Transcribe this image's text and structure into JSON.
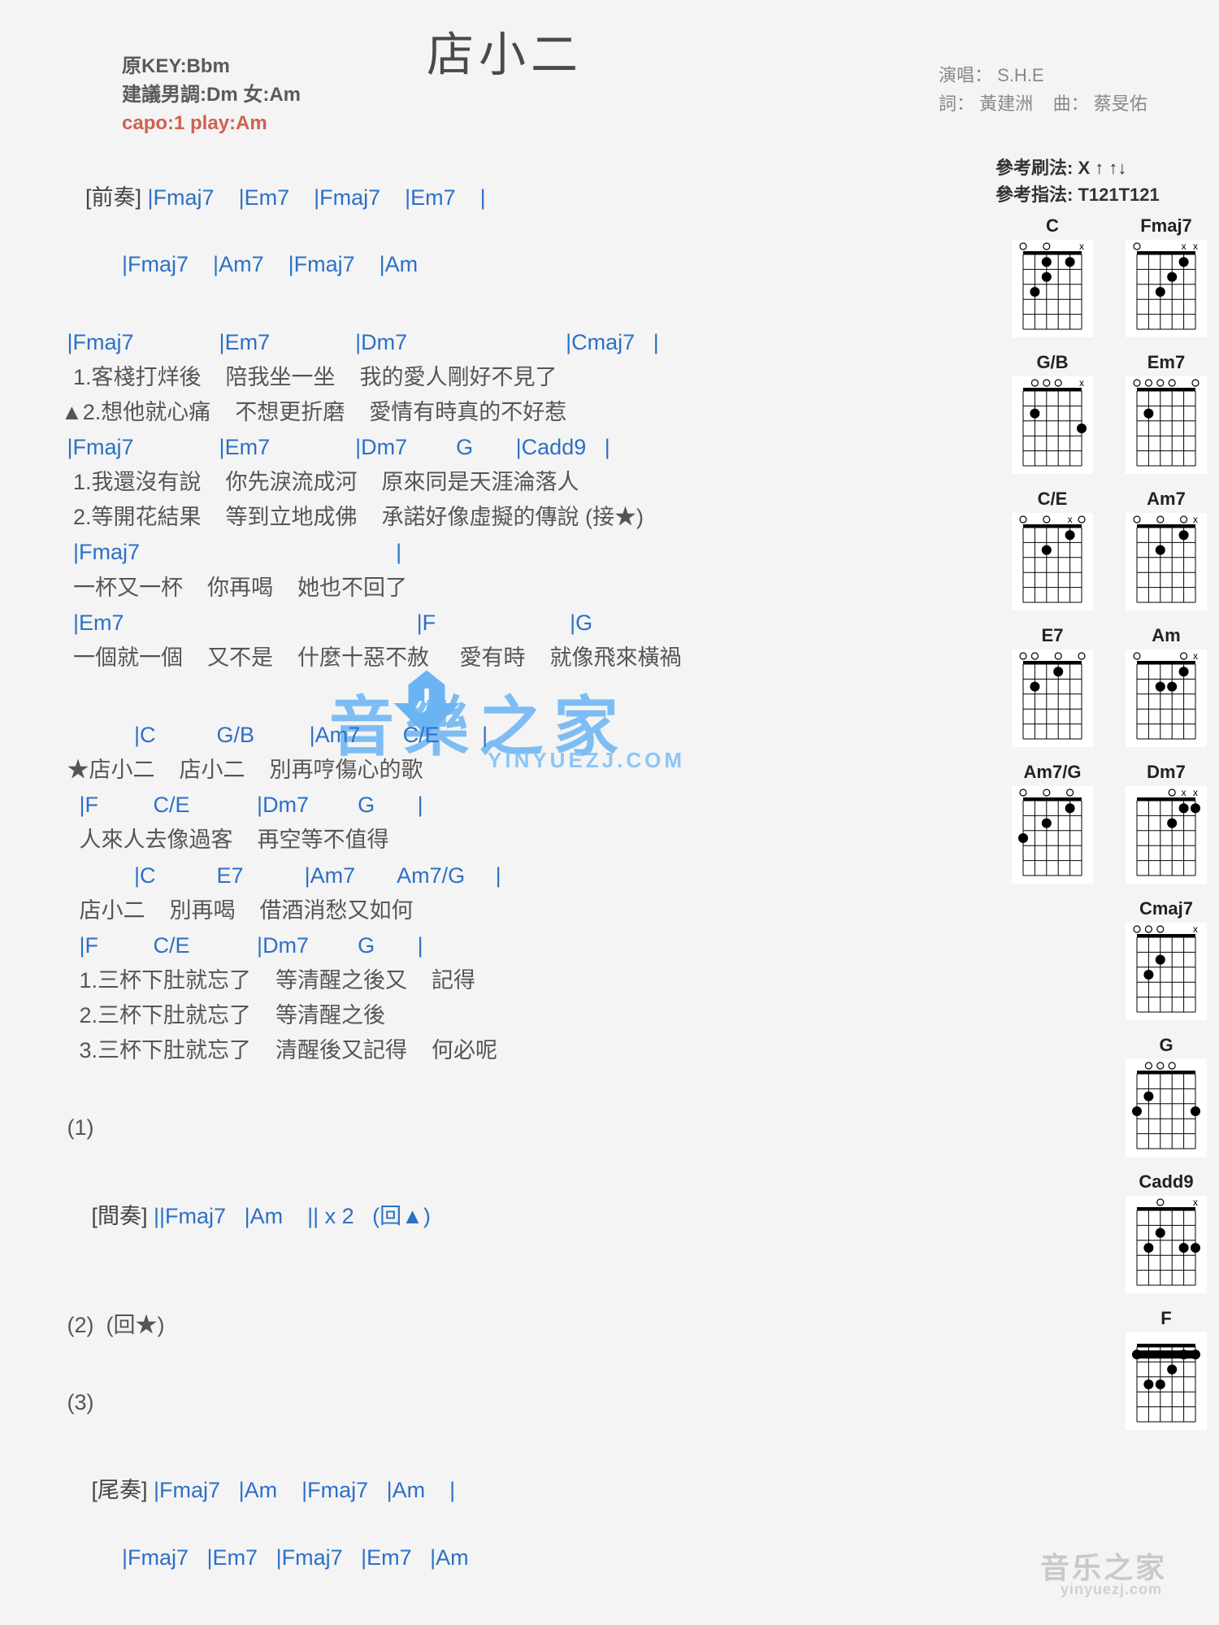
{
  "title": "店小二",
  "meta": {
    "original_key": "原KEY:Bbm",
    "suggest": "建議男調:Dm 女:Am",
    "capo": "capo:1 play:Am",
    "singer_label": "演唱：",
    "singer": "S.H.E",
    "lyricist_label": "詞：",
    "lyricist": "黃建洲",
    "composer_label": "曲：",
    "composer": "蔡旻佑",
    "strum_label": "參考刷法:",
    "strum": "X ↑ ↑↓",
    "finger_label": "參考指法:",
    "finger": "T121T121"
  },
  "sections": {
    "intro_label": "[前奏]",
    "intro_l1": " |Fmaj7    |Em7    |Fmaj7    |Em7    |",
    "intro_l2": "          |Fmaj7    |Am7    |Fmaj7    |Am",
    "v_c1": " |Fmaj7              |Em7              |Dm7                          |Cmaj7   |",
    "v_l1a": "  1.客棧打烊後    陪我坐一坐    我的愛人剛好不見了",
    "v_l1b": "▲2.想他就心痛    不想更折磨    愛情有時真的不好惹",
    "v_c2": " |Fmaj7              |Em7              |Dm7        G       |Cadd9   |",
    "v_l2a": "  1.我還沒有說    你先淚流成河    原來同是天涯淪落人",
    "v_l2b": "  2.等開花結果    等到立地成佛    承諾好像虛擬的傳說 (接★)",
    "v_c3": "  |Fmaj7                                          |",
    "v_l3": "  一杯又一杯    你再喝    她也不回了",
    "v_c4": "  |Em7                                                |F                      |G",
    "v_l4": "  一個就一個    又不是    什麼十惡不赦     愛有時    就像飛來橫禍",
    "ch_c1": "            |C          G/B         |Am7       C/E       |",
    "ch_l1": " ★店小二    店小二    別再哼傷心的歌",
    "ch_c2": "   |F         C/E           |Dm7        G       |",
    "ch_l2": "   人來人去像過客    再空等不值得",
    "ch_c3": "            |C          E7          |Am7       Am7/G     |",
    "ch_l3": "   店小二    別再喝    借酒消愁又如何",
    "ch_c4": "   |F         C/E           |Dm7        G       |",
    "ch_l4a": "   1.三杯下肚就忘了    等清醒之後又    記得",
    "ch_l4b": "   2.三杯下肚就忘了    等清醒之後",
    "ch_l4c": "   3.三杯下肚就忘了    清醒後又記得    何必呢",
    "p1": " (1)",
    "inter_label": " [間奏]",
    "inter": " ||Fmaj7   |Am    || x 2   (回▲)",
    "p2": " (2)  (回★)",
    "p3": " (3)",
    "outro_label": " [尾奏]",
    "outro_l1": " |Fmaj7   |Am    |Fmaj7   |Am    |",
    "outro_l2": "          |Fmaj7   |Em7   |Fmaj7   |Em7   |Am"
  },
  "chord_diagrams": [
    {
      "name": "C",
      "frets": [
        [
          -1,
          3,
          2,
          0,
          1,
          0
        ]
      ],
      "dots": [
        [
          1,
          2
        ],
        [
          2,
          4
        ],
        [
          3,
          5
        ],
        [
          1,
          4
        ]
      ]
    },
    {
      "name": "Fmaj7",
      "frets": [
        [
          -1,
          -1,
          3,
          2,
          1,
          0
        ]
      ],
      "dots": [
        [
          1,
          2
        ],
        [
          2,
          3
        ],
        [
          3,
          4
        ]
      ]
    },
    {
      "name": "G/B",
      "frets": [
        [
          -1,
          2,
          0,
          0,
          0,
          3
        ]
      ],
      "dots": [
        [
          2,
          5
        ],
        [
          3,
          1
        ]
      ]
    },
    {
      "name": "Em7",
      "frets": [
        [
          0,
          2,
          0,
          0,
          0,
          0
        ]
      ],
      "dots": [
        [
          2,
          5
        ]
      ]
    },
    {
      "name": "C/E",
      "frets": [
        [
          0,
          -1,
          2,
          0,
          1,
          0
        ]
      ],
      "dots": [
        [
          1,
          2
        ],
        [
          2,
          4
        ]
      ]
    },
    {
      "name": "Am7",
      "frets": [
        [
          -1,
          0,
          2,
          0,
          1,
          0
        ]
      ],
      "dots": [
        [
          1,
          2
        ],
        [
          2,
          4
        ]
      ]
    },
    {
      "name": "E7",
      "frets": [
        [
          0,
          2,
          0,
          1,
          0,
          0
        ]
      ],
      "dots": [
        [
          1,
          3
        ],
        [
          2,
          5
        ]
      ]
    },
    {
      "name": "Am",
      "frets": [
        [
          -1,
          0,
          2,
          2,
          1,
          0
        ]
      ],
      "dots": [
        [
          1,
          2
        ],
        [
          2,
          3
        ],
        [
          2,
          4
        ]
      ]
    },
    {
      "name": "Am7/G",
      "frets": [
        [
          3,
          0,
          2,
          0,
          1,
          0
        ]
      ],
      "dots": [
        [
          1,
          2
        ],
        [
          2,
          4
        ],
        [
          3,
          6
        ]
      ]
    },
    {
      "name": "Dm7",
      "frets": [
        [
          -1,
          -1,
          0,
          2,
          1,
          1
        ]
      ],
      "dots": [
        [
          1,
          1
        ],
        [
          1,
          2
        ],
        [
          2,
          3
        ]
      ]
    },
    {
      "name": "Cmaj7",
      "frets": [
        [
          -1,
          3,
          2,
          0,
          0,
          0
        ]
      ],
      "dots": [
        [
          2,
          4
        ],
        [
          3,
          5
        ]
      ]
    },
    {
      "name": "G",
      "frets": [
        [
          3,
          2,
          0,
          0,
          0,
          3
        ]
      ],
      "dots": [
        [
          2,
          5
        ],
        [
          3,
          1
        ],
        [
          3,
          6
        ]
      ]
    },
    {
      "name": "Cadd9",
      "frets": [
        [
          -1,
          3,
          2,
          0,
          3,
          3
        ]
      ],
      "dots": [
        [
          2,
          4
        ],
        [
          3,
          1
        ],
        [
          3,
          2
        ],
        [
          3,
          5
        ]
      ]
    },
    {
      "name": "F",
      "frets": [
        [
          1,
          3,
          3,
          2,
          1,
          1
        ]
      ],
      "dots": [
        [
          1,
          1
        ],
        [
          1,
          2
        ],
        [
          1,
          6
        ],
        [
          2,
          3
        ],
        [
          3,
          4
        ],
        [
          3,
          5
        ]
      ],
      "barre": 1
    }
  ],
  "chord_layout": [
    [
      "C",
      "Fmaj7"
    ],
    [
      "G/B",
      "Em7"
    ],
    [
      "C/E",
      "Am7"
    ],
    [
      "E7",
      "Am"
    ],
    [
      "Am7/G",
      "Dm7"
    ],
    [
      "Cmaj7"
    ],
    [
      "G"
    ],
    [
      "Cadd9"
    ],
    [
      "F"
    ]
  ],
  "watermark": {
    "main": "  音樂之家",
    "sub": "YINYUEZJ.COM",
    "small": "音乐之家",
    "small_sub": "yinyuezj.com"
  }
}
